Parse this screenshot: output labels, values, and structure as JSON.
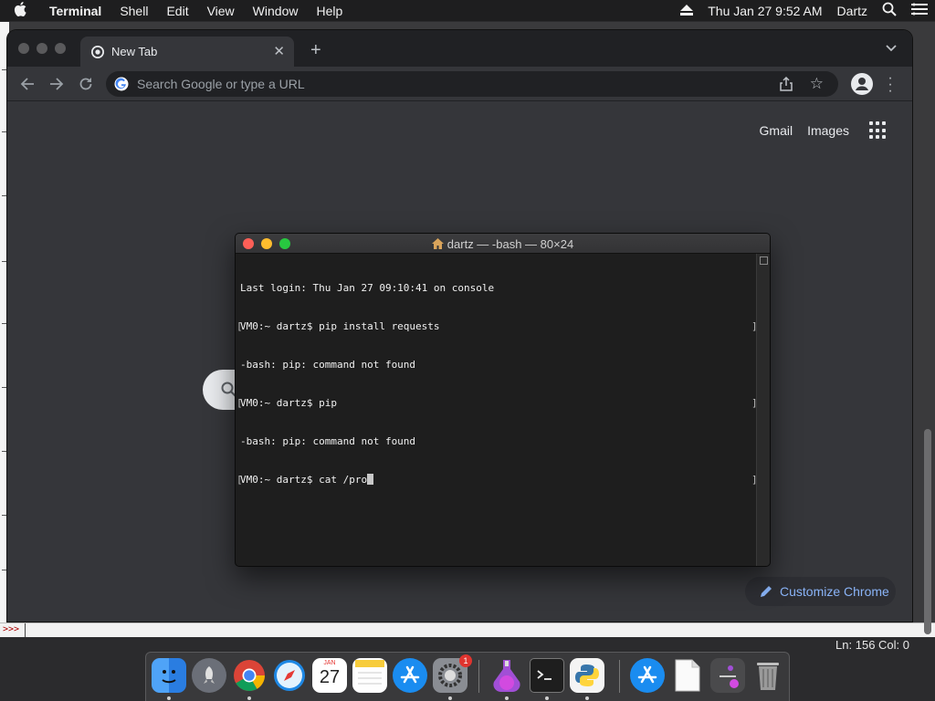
{
  "menubar": {
    "app_name": "Terminal",
    "items": [
      "Shell",
      "Edit",
      "View",
      "Window",
      "Help"
    ],
    "clock": "Thu Jan 27  9:52 AM",
    "user": "Dartz"
  },
  "editor": {
    "console_prompt": ">>>",
    "status": "Ln: 156   Col: 0"
  },
  "chrome": {
    "tab_title": "New Tab",
    "new_tab_symbol": "+",
    "omnibox_placeholder": "Search Google or type a URL",
    "ntp_links": {
      "gmail": "Gmail",
      "images": "Images"
    },
    "customize_label": "Customize Chrome",
    "accent_color": "#8ab4f8"
  },
  "terminal": {
    "title": "dartz — -bash — 80×24",
    "lines": [
      "Last login: Thu Jan 27 09:10:41 on console",
      "VM0:~ dartz$ pip install requests",
      "-bash: pip: command not found",
      "VM0:~ dartz$ pip",
      "-bash: pip: command not found",
      "VM0:~ dartz$ cat /pro"
    ]
  },
  "dock": {
    "items": [
      "Finder",
      "Launchpad",
      "Google Chrome",
      "Safari",
      "Calendar",
      "Notes",
      "App Store",
      "System Preferences",
      "Python Launcher",
      "Terminal",
      "Python",
      "Applications",
      "Document",
      "Downloads",
      "Trash"
    ],
    "calendar_month": "JAN",
    "calendar_day": "27",
    "system_prefs_badge": "1"
  }
}
